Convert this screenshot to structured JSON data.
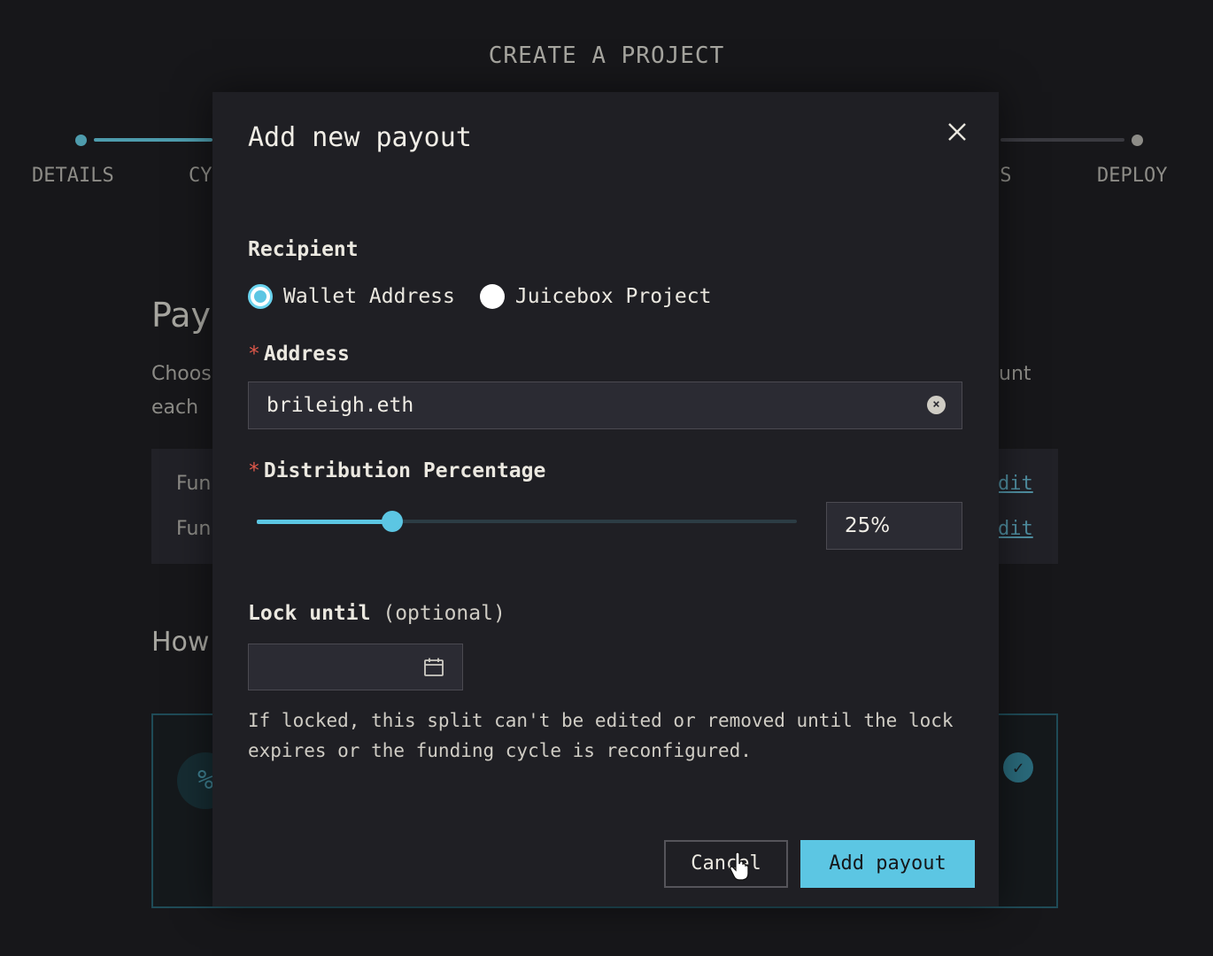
{
  "page": {
    "title": "CREATE A PROJECT"
  },
  "steps": [
    {
      "label": "DETAILS"
    },
    {
      "label": "CY"
    },
    {
      "label": "ES"
    },
    {
      "label": "DEPLOY"
    }
  ],
  "background": {
    "heading": "Pay",
    "desc_line1": "Choos",
    "desc_line2": "each",
    "desc_right": "unt",
    "row1_label": "Fun",
    "row1_link": "dit",
    "row2_label": "Fun",
    "row2_link": "dit",
    "section_heading": "How",
    "option_icon": "%"
  },
  "modal": {
    "title": "Add new payout",
    "recipient_label": "Recipient",
    "recipient_options": [
      {
        "label": "Wallet Address",
        "selected": true
      },
      {
        "label": "Juicebox Project",
        "selected": false
      }
    ],
    "required_mark": "*",
    "address_label": "Address",
    "address_value": "brileigh.eth",
    "distribution_label": "Distribution Percentage",
    "distribution_value": "25%",
    "distribution_fraction": 0.25,
    "lock_label": "Lock until",
    "lock_optional": "(optional)",
    "lock_value": "",
    "help_text": "If locked, this split can't be edited or removed until the lock expires or the funding cycle is reconfigured.",
    "cancel_label": "Cancel",
    "add_label": "Add payout"
  },
  "colors": {
    "accent": "#5cc6e3",
    "background": "#17171a",
    "modal": "#1f1f24",
    "required": "#e0584a"
  }
}
